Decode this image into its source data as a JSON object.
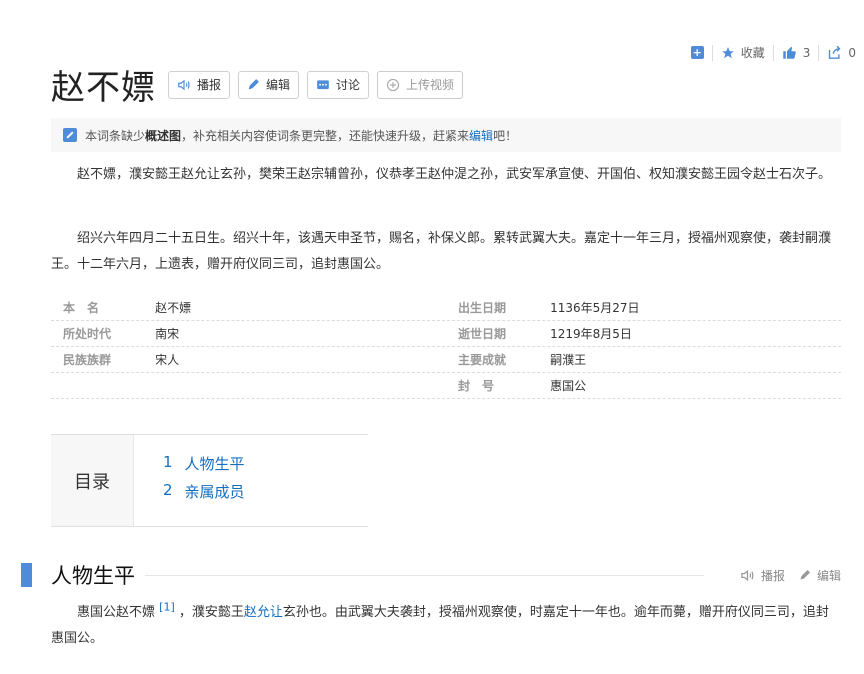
{
  "topbar": {
    "collect_label": "收藏",
    "like_count": "3",
    "share_count": "0"
  },
  "title": "赵不嫖",
  "actions": {
    "play": "播报",
    "edit": "编辑",
    "discuss": "讨论",
    "upload": "上传视频"
  },
  "notice": {
    "prefix": "本词条缺少",
    "bold": "概述图",
    "middle": "，补充相关内容使词条更完整，还能快速升级，赶紧来",
    "link": "编辑",
    "suffix": "吧！"
  },
  "paragraphs": [
    "赵不嫖，濮安懿王赵允让玄孙，樊荣王赵宗辅曾孙，仪恭孝王赵仲湜之孙，武安军承宣使、开国伯、权知濮安懿王园令赵士石次子。",
    "绍兴六年四月二十五日生。绍兴十年，该遇天申圣节，赐名，补保义郎。累转武翼大夫。嘉定十一年三月，授福州观察使，袭封嗣濮王。十二年六月，上遗表，赠开府仪同三司，追封惠国公。"
  ],
  "basic_info": [
    {
      "n1": "本　名",
      "v1": "赵不嫖",
      "n2": "出生日期",
      "v2": "1136年5月27日"
    },
    {
      "n1": "所处时代",
      "v1": "南宋",
      "n2": "逝世日期",
      "v2": "1219年8月5日"
    },
    {
      "n1": "民族族群",
      "v1": "宋人",
      "n2": "主要成就",
      "v2": "嗣濮王"
    },
    {
      "n1": "",
      "v1": "",
      "n2": "封　号",
      "v2": "惠国公"
    }
  ],
  "toc": {
    "label": "目录",
    "items": [
      {
        "num": "1",
        "text": "人物生平"
      },
      {
        "num": "2",
        "text": "亲属成员"
      }
    ]
  },
  "section": {
    "title": "人物生平",
    "play": "播报",
    "edit": "编辑",
    "p_a": "惠国公赵不嫖",
    "ref": "[1]",
    "p_b": "，濮安懿王",
    "p_link": "赵允让",
    "p_c": "玄孙也。由武翼大夫袭封，授福州观察使，时嘉定十一年也。逾年而薨，赠开府仪同三司，追封惠国公。"
  },
  "colors": {
    "accent": "#4e8cd9",
    "link": "#136ec2"
  }
}
